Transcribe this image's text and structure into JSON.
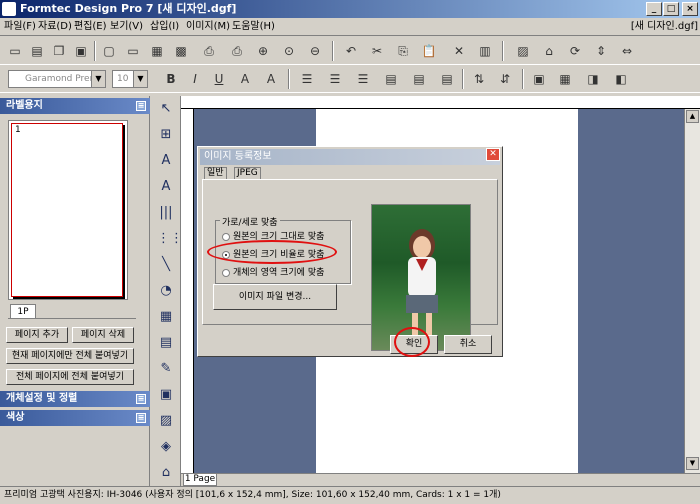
{
  "window": {
    "title": "Formtec Design Pro 7 [새 디자인.dgf]"
  },
  "menu": {
    "items": [
      "파일(F)",
      "자료(D)",
      "편집(E)",
      "보기(V)",
      "삽입(I)",
      "이미지(M)",
      "도움말(H)"
    ],
    "doc_label": "[새 디자인.dgf]"
  },
  "format_bar": {
    "font": "Garamond Premr",
    "size": "10"
  },
  "left_panel": {
    "header_label": "라벨용지",
    "label_number": "1",
    "page_tab": "1P",
    "add_page": "페이지 추가",
    "delete_page": "페이지 삭제",
    "paste_current": "현재 페이지에만 전체 붙여넣기",
    "paste_all": "전체 페이지에 전체 붙여넣기",
    "section_align": "개체설정 및 정렬",
    "section_color": "색상"
  },
  "page_tab": "1 Page",
  "status": "프리미엄 고광택 사진용지: IH-3046 (사용자 정의 [101,6 x 152,4 mm], Size: 101,60 x 152,40 mm,  Cards: 1 x 1 = 1개)",
  "dialog": {
    "title": "이미지 등록정보",
    "tab_general": "일반",
    "tab_jpeg": "JPEG",
    "group_label": "가로/세로 맞춤",
    "radio_1": "원본의 크기 그대로 맞춤",
    "radio_2": "원본의 크기 비율로 맞춤",
    "radio_3": "개체의 영역 크기에 맞춤",
    "change_file": "이미지 파일 변경...",
    "ok": "확인",
    "cancel": "취소",
    "selected_radio": 2
  },
  "colors": {
    "title_start": "#0a246a",
    "panel_head": "#3a5a9a",
    "canvas_bg": "#5a6a8c",
    "highlight": "#e01010"
  }
}
